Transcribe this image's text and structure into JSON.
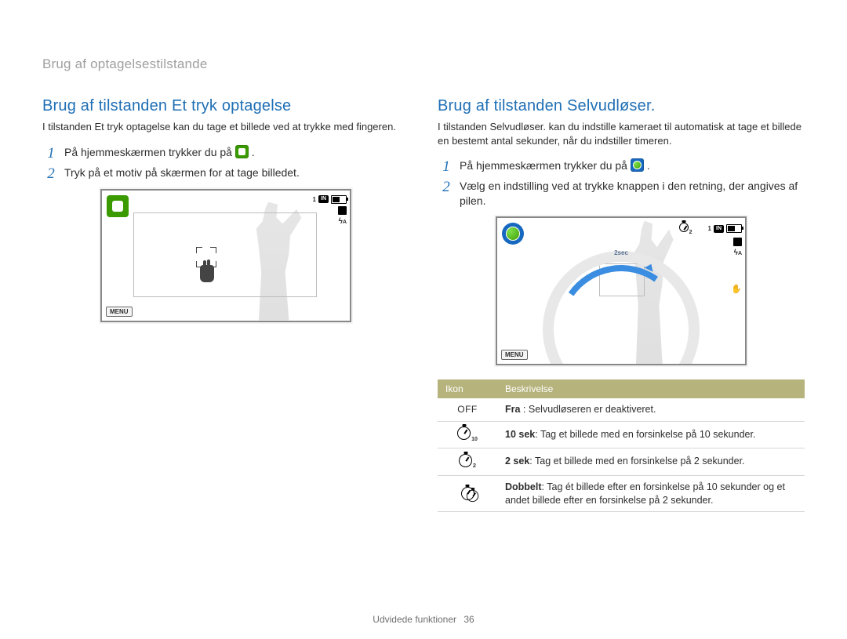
{
  "header": "Brug af optagelsestilstande",
  "left": {
    "heading": "Brug af tilstanden Et tryk optagelse",
    "intro": "I tilstanden Et tryk optagelse kan du tage et billede ved at trykke med fingeren.",
    "steps": [
      "På hjemmeskærmen trykker du på",
      "Tryk på et motiv på skærmen for at tage billedet."
    ],
    "screen": {
      "counter": "1",
      "storage": "IN",
      "menu": "MENU"
    }
  },
  "right": {
    "heading": "Brug af tilstanden Selvudløser.",
    "intro": "I tilstanden Selvudløser. kan du indstille kameraet til automatisk at tage et billede en bestemt antal sekunder, når du indstiller timeren.",
    "steps": [
      "På hjemmeskærmen trykker du på",
      "Vælg en indstilling ved at trykke knappen i den retning, der angives af pilen."
    ],
    "screen": {
      "counter": "1",
      "storage": "IN",
      "menu": "MENU",
      "dial": "2sec"
    },
    "table": {
      "headers": [
        "Ikon",
        "Beskrivelse"
      ],
      "rows": [
        {
          "icon": "OFF",
          "bold": "Fra",
          "desc": " : Selvudløseren er deaktiveret."
        },
        {
          "icon": "timer10",
          "bold": "10 sek",
          "desc": ": Tag et billede med en forsinkelse på 10 sekunder."
        },
        {
          "icon": "timer2",
          "bold": "2 sek",
          "desc": ": Tag et billede med en forsinkelse på 2 sekunder."
        },
        {
          "icon": "timerDouble",
          "bold": "Dobbelt",
          "desc": ": Tag ét billede efter en forsinkelse på 10 sekunder og et andet billede efter en forsinkelse på 2 sekunder."
        }
      ]
    }
  },
  "footer": {
    "section": "Udvidede funktioner",
    "page": "36"
  }
}
